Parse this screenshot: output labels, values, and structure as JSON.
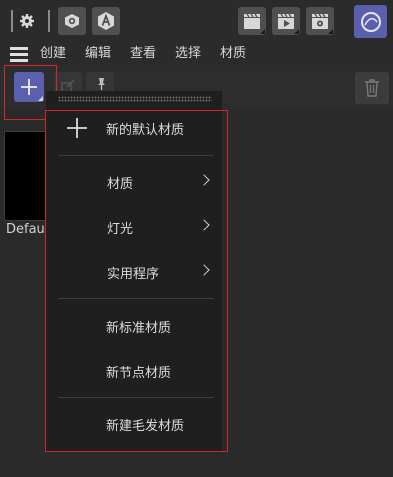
{
  "colors": {
    "accent": "#5a5fae",
    "highlight_red": "#d4252b",
    "menu_bg": "#1f1f1f"
  },
  "toolbar": {
    "icons": [
      "settings-gear-icon",
      "eye-icon",
      "font-a-icon",
      "clapperboard-icon",
      "play-clapper-icon",
      "render-settings-icon",
      "redshift-logo-icon"
    ]
  },
  "menubar": {
    "items": [
      "创建",
      "编辑",
      "查看",
      "选择",
      "材质"
    ]
  },
  "panel": {
    "add_icon": "plus-icon",
    "thumbnail_label": "Defau"
  },
  "dropdown": {
    "new_default": "新的默认材质",
    "materials": "材质",
    "lights": "灯光",
    "utilities": "实用程序",
    "new_standard": "新标准材质",
    "new_node": "新节点材质",
    "new_hair": "新建毛发材质"
  }
}
